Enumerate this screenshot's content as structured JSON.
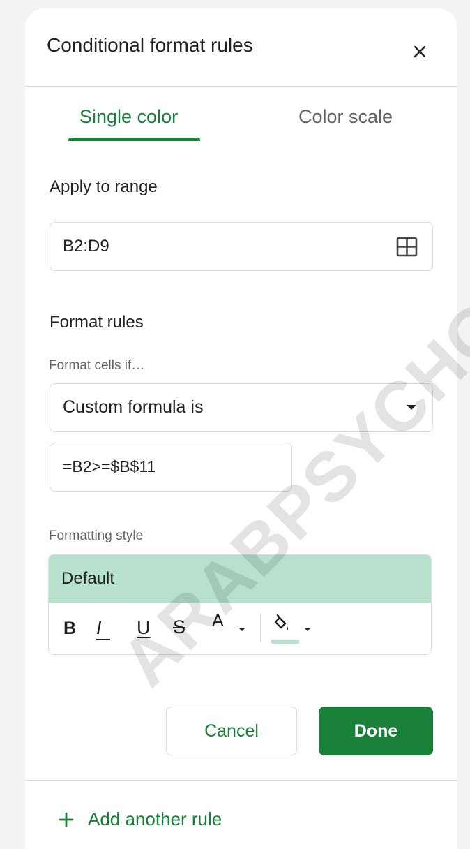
{
  "panel": {
    "title": "Conditional format rules"
  },
  "tabs": [
    {
      "label": "Single color",
      "active": true
    },
    {
      "label": "Color scale",
      "active": false
    }
  ],
  "range": {
    "label": "Apply to range",
    "value": "B2:D9"
  },
  "rules": {
    "label": "Format rules",
    "condition_label": "Format cells if…",
    "condition_value": "Custom formula is",
    "formula_value": "=B2>=$B$11"
  },
  "style": {
    "label": "Formatting style",
    "preview": "Default",
    "preview_color": "#b7e1cd",
    "toolbar": {
      "bold": "B",
      "italic": "I",
      "underline": "U",
      "strikethrough": "S",
      "text_color": "A"
    }
  },
  "actions": {
    "cancel": "Cancel",
    "done": "Done"
  },
  "footer": {
    "add_rule": "Add another rule"
  },
  "watermark": "ARABPSYCHO",
  "colors": {
    "accent": "#188038",
    "border": "#dadce0"
  }
}
